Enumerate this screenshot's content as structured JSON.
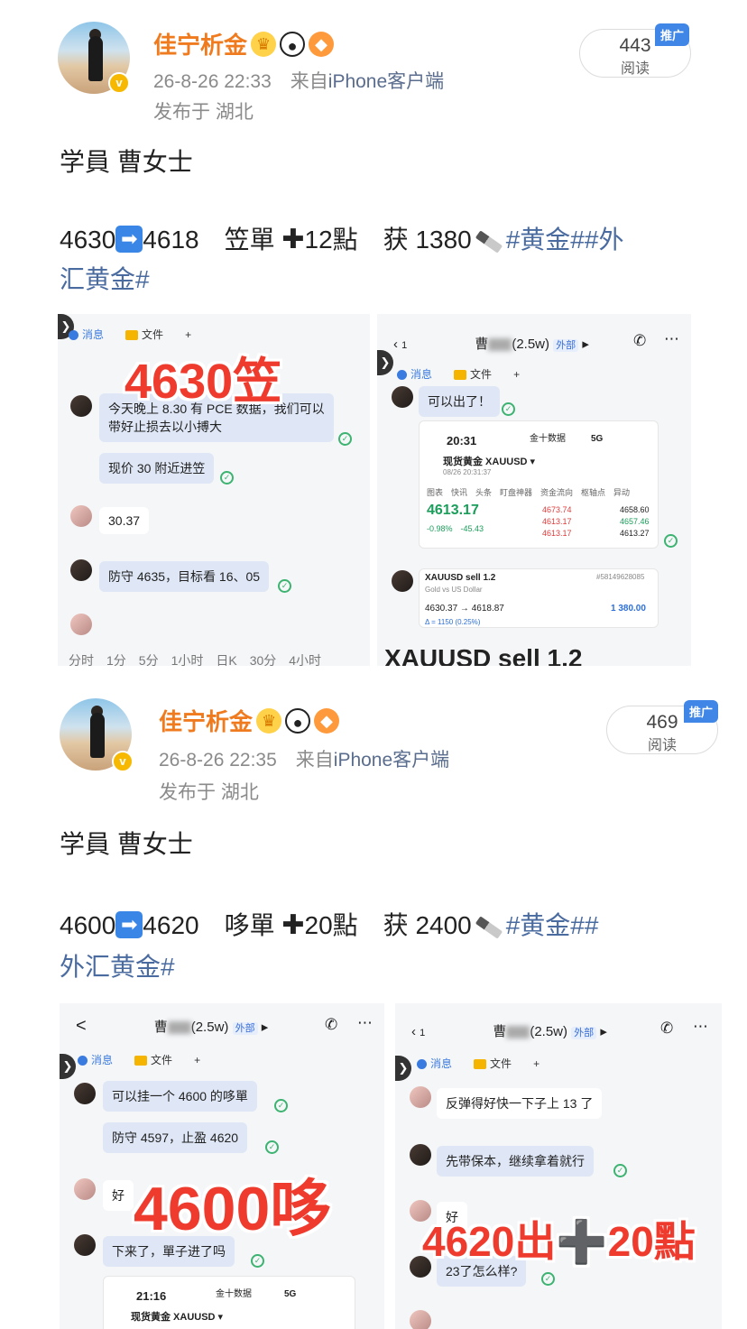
{
  "posts": [
    {
      "username": "佳宁析金",
      "timestamp": "26-8-26 22:33",
      "source_prefix": "来自",
      "source": "iPhone客户端",
      "location": "发布于 湖北",
      "reads": "443",
      "reads_label": "阅读",
      "promo": "推广",
      "line1": "学員 曹女士",
      "line2_a": "4630",
      "line2_b": "4618　笠單",
      "line2_c": "12點　获 1380",
      "tag_a": "#黄金##外",
      "tag_b": "汇黄金#",
      "shot_left": {
        "tab_msg": "消息",
        "tab_file": "文件",
        "tab_plus": "+",
        "overlay": "4630笠",
        "b1": "今天晚上 8.30 有 PCE 数据，我们可以",
        "b1b": "带好止损去以小搏大",
        "b2": "现价 30 附近进笠",
        "b3": "30.37",
        "b4": "防守 4635，目标看 16、05",
        "timeframes": "分时　1分　5分　1小时　日K　30分　4小时"
      },
      "shot_right": {
        "back": "1",
        "contact_suffix": "(2.5w)",
        "ext": "外部",
        "tab_msg": "消息",
        "tab_file": "文件",
        "tab_plus": "+",
        "b1": "可以出了！",
        "time": "20:31",
        "app": "金十数据",
        "signal": "5G",
        "instrument": "现货黄金 XAUUSD ▾",
        "date": "08/26 20:31:37",
        "tabs": "图表　快讯　头条　盯盘神器　资金流向　枢轴点　异动",
        "price": "4613.17",
        "change": "-0.98%　-45.43",
        "hi": "4673.74",
        "lo": "4613.17",
        "last": "4613.17",
        "prev": "4658.60",
        "open": "4657.46",
        "sell": "4613.27",
        "order_title": "XAUUSD sell 1.2",
        "order_id": "#58149628085",
        "order_sub": "Gold vs US Dollar",
        "order_move": "4630.37 → 4618.87",
        "order_pnl": "1 380.00",
        "order_pct": "Δ = 1150 (0.25%)",
        "banner": "XAUUSD sell 1.2"
      }
    },
    {
      "username": "佳宁析金",
      "timestamp": "26-8-26 22:35",
      "source_prefix": "来自",
      "source": "iPhone客户端",
      "location": "发布于 湖北",
      "reads": "469",
      "reads_label": "阅读",
      "promo": "推广",
      "line1": "学員 曹女士",
      "line2_a": "4600",
      "line2_b": "4620　哆單",
      "line2_c": "20點　获 2400",
      "tag_a": "#黄金##",
      "tag_b": "外汇黄金#",
      "shot_left": {
        "back": "<",
        "contact_suffix": "(2.5w)",
        "ext": "外部",
        "tab_msg": "消息",
        "tab_file": "文件",
        "tab_plus": "+",
        "b1": "可以挂一个 4600 的哆單",
        "b2": "防守 4597，止盈 4620",
        "b3": "好",
        "b4": "下来了，單子进了吗",
        "overlay": "4600哆",
        "time": "21:16",
        "app": "金十数据",
        "signal": "5G",
        "instrument": "现货黄金 XAUUSD ▾"
      },
      "shot_right": {
        "back": "1",
        "contact_suffix": "(2.5w)",
        "ext": "外部",
        "tab_msg": "消息",
        "tab_file": "文件",
        "tab_plus": "+",
        "b1": "反弹得好快一下子上 13 了",
        "b2": "先带保本，继续拿着就行",
        "b3": "好",
        "b4": "23了怎么样?",
        "overlay": "4620出➕20點"
      }
    }
  ],
  "colors": {
    "username": "#f07b1e",
    "tag": "#4a6ba0",
    "promo": "#3f86e6",
    "overlay": "#ef3b2e"
  }
}
